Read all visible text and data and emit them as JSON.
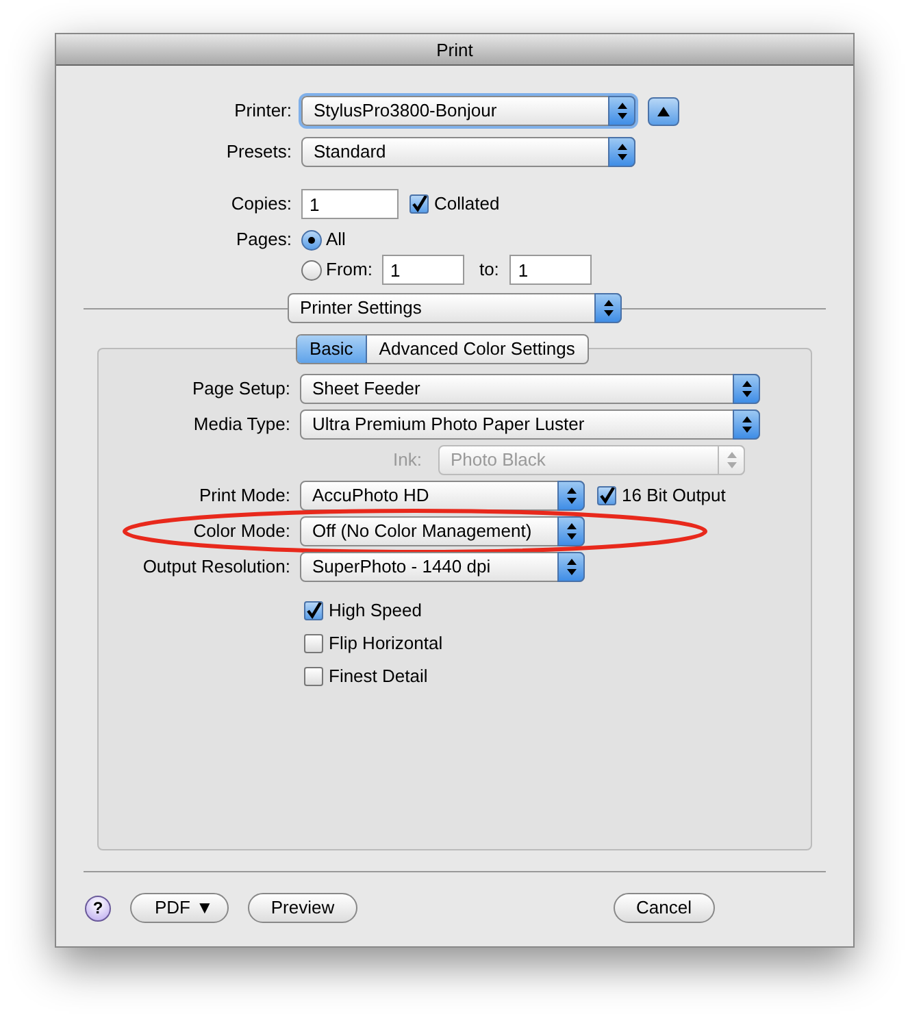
{
  "window": {
    "title": "Print"
  },
  "printer": {
    "label": "Printer:",
    "value": "StylusPro3800-Bonjour",
    "focused": true
  },
  "presets": {
    "label": "Presets:",
    "value": "Standard"
  },
  "copies": {
    "label": "Copies:",
    "value": "1",
    "collated": {
      "label": "Collated",
      "checked": true
    }
  },
  "pages": {
    "label": "Pages:",
    "options": [
      {
        "label": "All",
        "selected": true
      },
      {
        "label": "From:",
        "selected": false
      }
    ],
    "from": "1",
    "to_label": "to:",
    "to": "1"
  },
  "section_popup": {
    "value": "Printer Settings"
  },
  "tabs": [
    {
      "label": "Basic",
      "selected": true
    },
    {
      "label": "Advanced Color Settings",
      "selected": false
    }
  ],
  "settings": [
    {
      "kind": "long",
      "label": "Page Setup:",
      "value": "Sheet Feeder",
      "disabled": false,
      "circled": false
    },
    {
      "kind": "long",
      "label": "Media Type:",
      "value": "Ultra Premium Photo Paper Luster",
      "disabled": false,
      "circled": false
    },
    {
      "kind": "inset",
      "label": "Ink:",
      "value": "Photo Black",
      "disabled": true,
      "circled": false
    },
    {
      "kind": "short",
      "label": "Print Mode:",
      "value": "AccuPhoto HD",
      "disabled": false,
      "circled": false,
      "side_checkbox": {
        "label": "16 Bit Output",
        "checked": true
      }
    },
    {
      "kind": "short",
      "label": "Color Mode:",
      "value": "Off (No Color Management)",
      "disabled": false,
      "circled": true
    },
    {
      "kind": "short",
      "label": "Output Resolution:",
      "value": "SuperPhoto - 1440 dpi",
      "disabled": false,
      "circled": false
    }
  ],
  "options": [
    {
      "label": "High Speed",
      "checked": true
    },
    {
      "label": "Flip Horizontal",
      "checked": false
    },
    {
      "label": "Finest Detail",
      "checked": false
    }
  ],
  "footer": {
    "help": "?",
    "pdf": {
      "label": "PDF",
      "caret": "▼"
    },
    "buttons": [
      {
        "label": "Preview",
        "kind": "leading"
      },
      {
        "label": "Cancel",
        "kind": "trailing"
      }
    ]
  }
}
